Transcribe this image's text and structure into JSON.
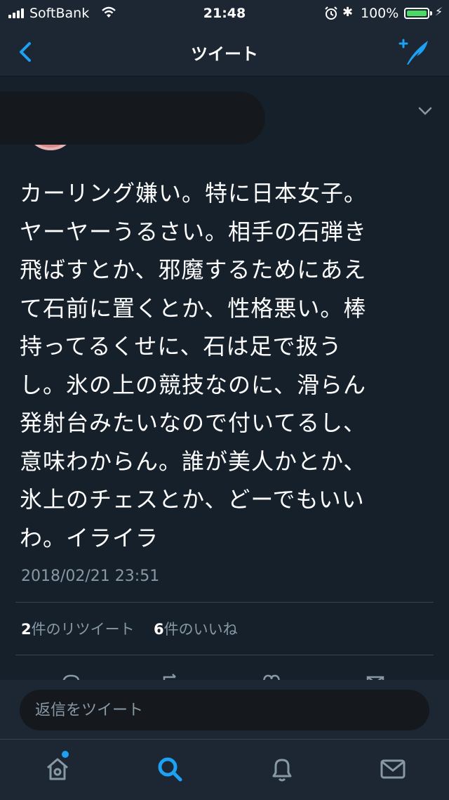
{
  "status_bar": {
    "carrier": "SoftBank",
    "time": "21:48",
    "battery": "100%",
    "battery_level": 1.0
  },
  "nav": {
    "title": "ツイート",
    "back_icon": "chevron-left-icon",
    "compose_icon": "compose-tweet-icon"
  },
  "tweet": {
    "text": "カーリング嫌い。特に日本女子。\nヤーヤーうるさい。相手の石弾き\n飛ばすとか、邪魔するためにあえ\nて石前に置くとか、性格悪い。棒\n持ってるくせに、石は足で扱う\nし。氷の上の競技なのに、滑らん\n発射台みたいなので付いてるし、\n意味わからん。誰が美人かとか、\n氷上のチェスとか、どーでもいい\nわ。イライラ",
    "timestamp": "2018/02/21 23:51"
  },
  "stats": {
    "retweet_count": "2",
    "retweet_label": "件のリツイート",
    "like_count": "6",
    "like_label": "件のいいね"
  },
  "reply": {
    "placeholder": "返信をツイート"
  },
  "tabs": [
    "home-icon",
    "search-icon",
    "notifications-icon",
    "messages-icon"
  ],
  "colors": {
    "background": "#15202b",
    "bar": "#1c2733",
    "accent": "#1da1f2",
    "secondary_text": "#8899a6",
    "battery_green": "#4cd964"
  }
}
